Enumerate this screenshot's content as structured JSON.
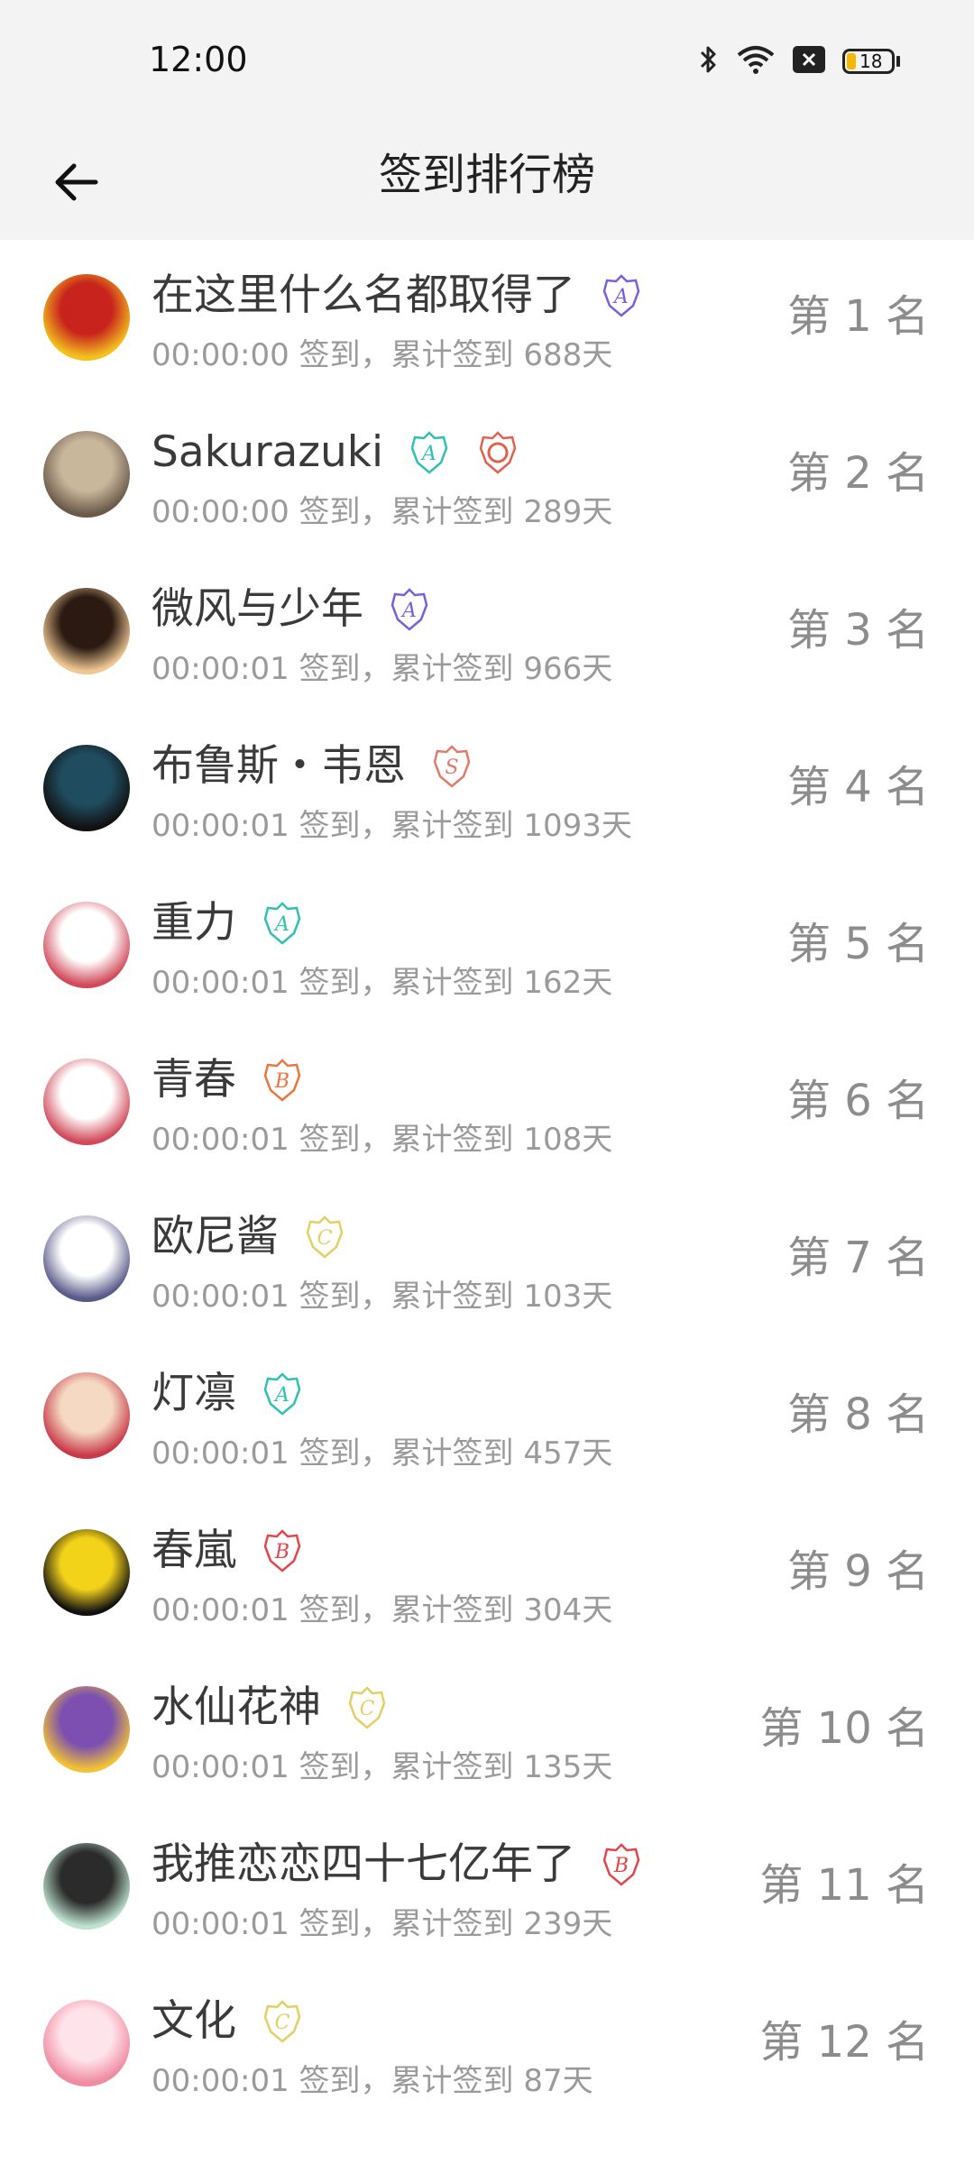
{
  "status_bar": {
    "time": "12:00",
    "battery": "18",
    "icons": [
      "bluetooth-icon",
      "wifi-icon",
      "notification-x-icon",
      "battery-icon"
    ]
  },
  "header": {
    "title": "签到排行榜",
    "back_icon": "back-arrow-icon"
  },
  "colors": {
    "purple": "#7b5fd9",
    "teal": "#2fbfb3",
    "orange": "#e7773f",
    "gold": "#e3cf64",
    "red": "#e0464b"
  },
  "entries": [
    {
      "name": "在这里什么名都取得了",
      "info": "00:00:00 签到，累计签到 688天",
      "rank": "第 1 名",
      "badges": [
        {
          "letter": "A",
          "color": "#7b5fd9"
        }
      ],
      "avatar": [
        "#c8241d",
        "#f4c21e"
      ]
    },
    {
      "name": "Sakurazuki",
      "info": "00:00:00 签到，累计签到 289天",
      "rank": "第 2 名",
      "badges": [
        {
          "letter": "A",
          "color": "#2fbfb3"
        },
        {
          "letter": "",
          "color": "#e0614b"
        }
      ],
      "avatar": [
        "#c9b79c",
        "#6b5a4a"
      ]
    },
    {
      "name": "微风与少年",
      "info": "00:00:01 签到，累计签到 966天",
      "rank": "第 3 名",
      "badges": [
        {
          "letter": "A",
          "color": "#7b5fd9"
        }
      ],
      "avatar": [
        "#2a1a12",
        "#f0c894"
      ]
    },
    {
      "name": "布鲁斯・韦恩",
      "info": "00:00:01 签到，累计签到 1093天",
      "rank": "第 4 名",
      "badges": [
        {
          "letter": "S",
          "color": "#e07a6a"
        }
      ],
      "avatar": [
        "#1f4c5e",
        "#111111"
      ]
    },
    {
      "name": "重力",
      "info": "00:00:01 签到，累计签到 162天",
      "rank": "第 5 名",
      "badges": [
        {
          "letter": "A",
          "color": "#2fbfb3"
        }
      ],
      "avatar": [
        "#ffffff",
        "#d14a5a"
      ]
    },
    {
      "name": "青春",
      "info": "00:00:01 签到，累计签到 108天",
      "rank": "第 6 名",
      "badges": [
        {
          "letter": "B",
          "color": "#e7773f"
        }
      ],
      "avatar": [
        "#ffffff",
        "#d14a5a"
      ]
    },
    {
      "name": "欧尼酱",
      "info": "00:00:01 签到，累计签到 103天",
      "rank": "第 7 名",
      "badges": [
        {
          "letter": "C",
          "color": "#e3cf64"
        }
      ],
      "avatar": [
        "#ffffff",
        "#5a5a8a"
      ]
    },
    {
      "name": "灯凛",
      "info": "00:00:01 签到，累计签到 457天",
      "rank": "第 8 名",
      "badges": [
        {
          "letter": "A",
          "color": "#2fbfb3"
        }
      ],
      "avatar": [
        "#f5d9c2",
        "#c8394a"
      ]
    },
    {
      "name": "春嵐",
      "info": "00:00:01 签到，累计签到 304天",
      "rank": "第 9 名",
      "badges": [
        {
          "letter": "B",
          "color": "#e0464b"
        }
      ],
      "avatar": [
        "#f3d21a",
        "#111111"
      ]
    },
    {
      "name": "水仙花神",
      "info": "00:00:01 签到，累计签到 135天",
      "rank": "第 10 名",
      "badges": [
        {
          "letter": "C",
          "color": "#e3cf64"
        }
      ],
      "avatar": [
        "#7c4fb0",
        "#f2c236"
      ]
    },
    {
      "name": "我推恋恋四十七亿年了",
      "info": "00:00:01 签到，累计签到 239天",
      "rank": "第 11 名",
      "badges": [
        {
          "letter": "B",
          "color": "#e0464b"
        }
      ],
      "avatar": [
        "#2b2b2b",
        "#bfe3d0"
      ]
    },
    {
      "name": "文化",
      "info": "00:00:01 签到，累计签到 87天",
      "rank": "第 12 名",
      "badges": [
        {
          "letter": "C",
          "color": "#e3cf64"
        }
      ],
      "avatar": [
        "#ffe3ea",
        "#ef8aa0"
      ]
    }
  ]
}
